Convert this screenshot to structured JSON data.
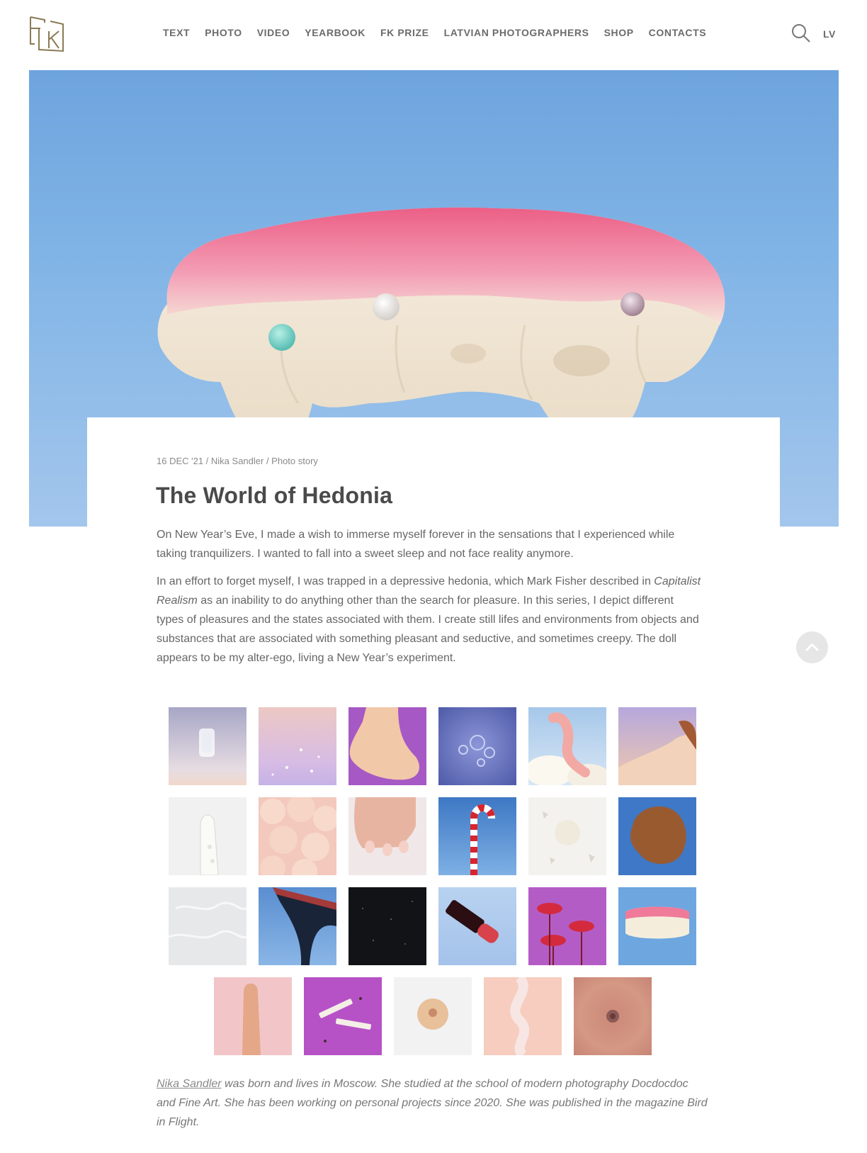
{
  "header": {
    "logo_text": "FK",
    "nav": [
      "TEXT",
      "PHOTO",
      "VIDEO",
      "YEARBOOK",
      "FK PRIZE",
      "LATVIAN PHOTOGRAPHERS",
      "SHOP",
      "CONTACTS"
    ],
    "language": "LV",
    "search_icon": "search-icon"
  },
  "colors": {
    "nav_text": "#6b6b6b",
    "hero_sky": "#80b4e6",
    "gum_pink": "#ef7a99",
    "scroll_button": "#e6e6e6"
  },
  "article": {
    "meta": "16 DEC '21 / Nika Sandler / Photo story",
    "title": "The World of Hedonia",
    "paragraph1": "On New Year’s Eve, I made a wish to immerse myself forever in the sensations that I experienced while taking tranquilizers. I wanted to fall into a sweet sleep and not face reality anymore.",
    "paragraph2_part1": "In an effort to forget myself, I was trapped in a depressive hedonia, which Mark Fisher described in ",
    "paragraph2_em": "Capitalist Realism",
    "paragraph2_part2": " as an inability to do anything other than the search for pleasure. In this series, I depict different types of pleasures and the states associated with them. I create still lifes and environments from objects and substances that are associated with something pleasant and seductive, and sometimes creepy. The doll appears to be my alter-ego, living a New Year’s experiment.",
    "bio_link": "Nika Sandler",
    "bio_text": " was born and lives in Moscow. She studied at the school of modern photography Docdocdoc and Fine Art. She has been working on personal projects since 2020. She was published in the magazine Bird in Flight."
  },
  "gallery": {
    "thumbnails": [
      {
        "subject": "glass",
        "icon": "ice-cube-thumbnail"
      },
      {
        "subject": "sparkles",
        "icon": "sparkle-thumbnail"
      },
      {
        "subject": "doll-foot",
        "icon": "foot-thumbnail"
      },
      {
        "subject": "bubbles",
        "icon": "bubbles-thumbnail"
      },
      {
        "subject": "gummy-worm",
        "icon": "worm-thumbnail"
      },
      {
        "subject": "doll-face",
        "icon": "doll-face-thumbnail"
      },
      {
        "subject": "condom",
        "icon": "condom-thumbnail"
      },
      {
        "subject": "pink-foam",
        "icon": "foam-thumbnail"
      },
      {
        "subject": "hand",
        "icon": "hand-thumbnail"
      },
      {
        "subject": "candy-cane",
        "icon": "candy-cane-thumbnail"
      },
      {
        "subject": "shell",
        "icon": "shell-thumbnail"
      },
      {
        "subject": "hair",
        "icon": "hair-thumbnail"
      },
      {
        "subject": "white-texture",
        "icon": "texture-thumbnail"
      },
      {
        "subject": "high-heel",
        "icon": "heel-thumbnail"
      },
      {
        "subject": "black-glitter",
        "icon": "glitter-thumbnail"
      },
      {
        "subject": "lipstick",
        "icon": "lipstick-thumbnail"
      },
      {
        "subject": "lips",
        "icon": "lips-thumbnail"
      },
      {
        "subject": "gummy-teeth",
        "icon": "teeth-thumbnail"
      },
      {
        "subject": "dildo",
        "icon": "dildo-thumbnail"
      },
      {
        "subject": "cigarettes",
        "icon": "cigarettes-thumbnail"
      },
      {
        "subject": "breast",
        "icon": "breast-thumbnail"
      },
      {
        "subject": "rope",
        "icon": "rope-thumbnail"
      },
      {
        "subject": "navel",
        "icon": "navel-thumbnail"
      }
    ]
  }
}
